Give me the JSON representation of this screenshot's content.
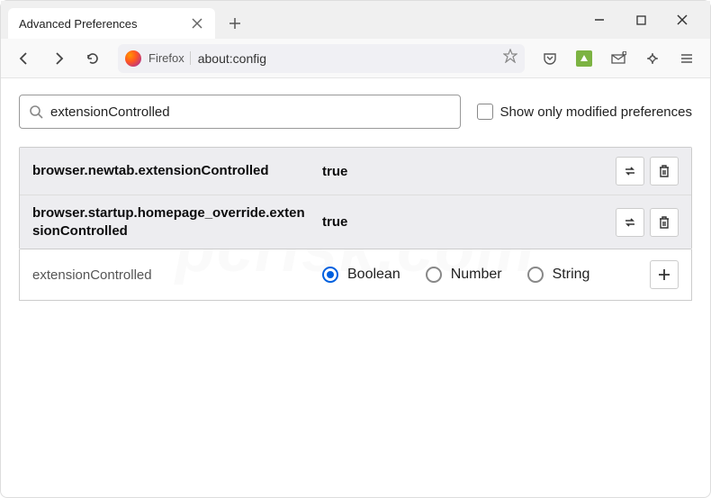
{
  "tab": {
    "title": "Advanced Preferences"
  },
  "urlbar": {
    "identity": "Firefox",
    "url": "about:config"
  },
  "search": {
    "value": "extensionControlled",
    "checkbox_label": "Show only modified preferences"
  },
  "prefs": {
    "rows": [
      {
        "name": "browser.newtab.extensionControlled",
        "value": "true"
      },
      {
        "name": "browser.startup.homepage_override.extensionControlled",
        "value": "true"
      }
    ]
  },
  "new_pref": {
    "name": "extensionControlled",
    "types": {
      "boolean": "Boolean",
      "number": "Number",
      "string": "String"
    }
  }
}
